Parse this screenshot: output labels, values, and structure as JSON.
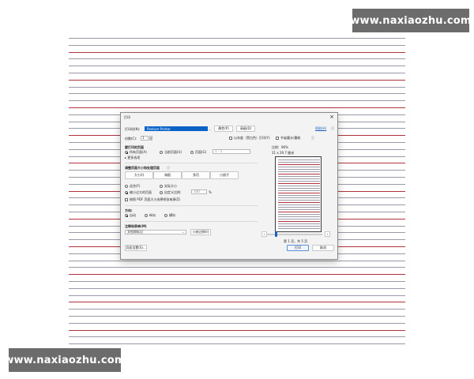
{
  "watermark": {
    "top": "www.naxiaozhu.com",
    "bottom": "www.naxiaozhu.com"
  },
  "dialog": {
    "title": "打印",
    "printer": {
      "label": "打印机(N):",
      "value": "Pantum Printer",
      "properties_button": "属性(P)",
      "advanced_button": "高级(D)",
      "help_link": "帮助(H)"
    },
    "copies": {
      "label": "份数(C):",
      "value": "1",
      "grayscale_label": "以灰度（黑白色）打印(Y)",
      "save_ink_label": "节省墨水/墨粉"
    },
    "range": {
      "heading": "要打印的页面",
      "all_pages": "所有页面(A)",
      "current_page": "当前页面(U)",
      "pages": "页面(G)",
      "pages_value": "1 - 5",
      "more_options": "▸ 更多选项"
    },
    "sizing": {
      "heading": "调整页面大小和处理页面",
      "buttons": [
        "大小(I)",
        "海报",
        "多页",
        "小册子"
      ],
      "fit": "适合(F)",
      "actual_size": "实际大小",
      "shrink_oversized": "缩小过大的页面",
      "custom_scale": "自定义比例:",
      "custom_scale_value": "100",
      "percent": "%",
      "pdf_paper_source": "按照 PDF 页面大小选择纸张来源(Z)"
    },
    "orientation": {
      "heading": "方向:",
      "auto": "自动",
      "portrait": "纵向",
      "landscape": "横向"
    },
    "comments": {
      "heading": "注释和表单(M)",
      "select_value": "文档和标记",
      "summarize_button": "小结注释(I)"
    },
    "page_setup_button": "页面设置(S)...",
    "preview": {
      "scale_label": "比例:",
      "scale_value": "96%",
      "paper_size": "21 x 29.7 厘米",
      "page_indicator": "第 1 页，共 5 页"
    },
    "print_button": "打印",
    "cancel_button": "取消"
  }
}
